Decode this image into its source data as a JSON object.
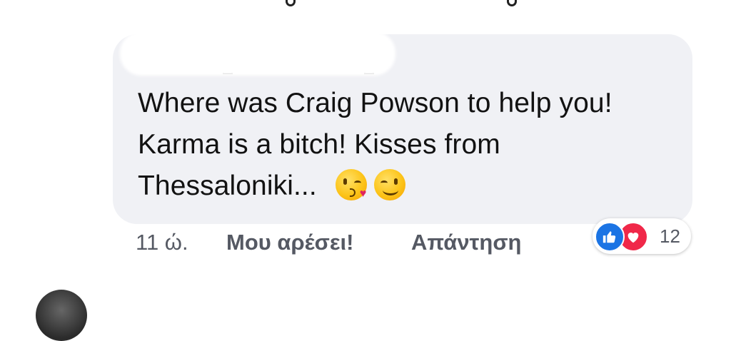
{
  "comment": {
    "lines": [
      "Where was Craig Powson to help you!",
      "Karma is a bitch! Kisses from",
      "Thessaloniki..."
    ],
    "emojis": [
      "face-blowing-kiss-emoji",
      "winking-face-emoji"
    ]
  },
  "meta": {
    "time": "11 ώ.",
    "like_label": "Μου αρέσει!",
    "reply_label": "Απάντηση"
  },
  "reactions": {
    "icons": [
      "like-reaction-icon",
      "love-reaction-icon"
    ],
    "count": "12",
    "colors": {
      "like": "#1b74e4",
      "love": "#f02849"
    }
  }
}
